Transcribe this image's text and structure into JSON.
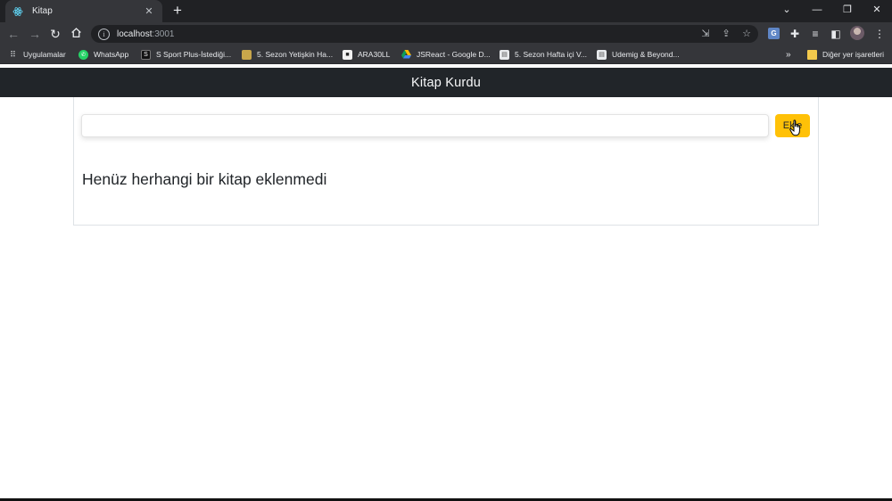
{
  "browser": {
    "tab": {
      "title": "Kitap"
    },
    "address_bar": {
      "host": "localhost",
      "port": ":3001"
    },
    "bookmarks": [
      {
        "label": "Uygulamalar",
        "icon": "apps-grid-icon"
      },
      {
        "label": "WhatsApp",
        "icon": "whatsapp-icon"
      },
      {
        "label": "S Sport Plus-İstediği...",
        "icon": "ssport-icon"
      },
      {
        "label": "5. Sezon Yetişkin Ha...",
        "icon": "image-icon"
      },
      {
        "label": "ARA30LL",
        "icon": "bookmark-icon"
      },
      {
        "label": "JSReact - Google D...",
        "icon": "google-drive-icon"
      },
      {
        "label": "5. Sezon Hafta içi V...",
        "icon": "doc-icon"
      },
      {
        "label": "Udemig & Beyond...",
        "icon": "doc-icon"
      }
    ],
    "overflow": "»",
    "other_bookmarks": "Diğer yer işaretleri"
  },
  "app": {
    "title": "Kitap Kurdu",
    "input": {
      "value": "",
      "placeholder": ""
    },
    "add_button": "Ekle",
    "empty_message": "Henüz herhangi bir kitap eklenmedi"
  },
  "colors": {
    "navbar": "#212529",
    "button": "#ffc107",
    "browser_frame": "#202124",
    "browser_toolbar": "#35363a"
  }
}
